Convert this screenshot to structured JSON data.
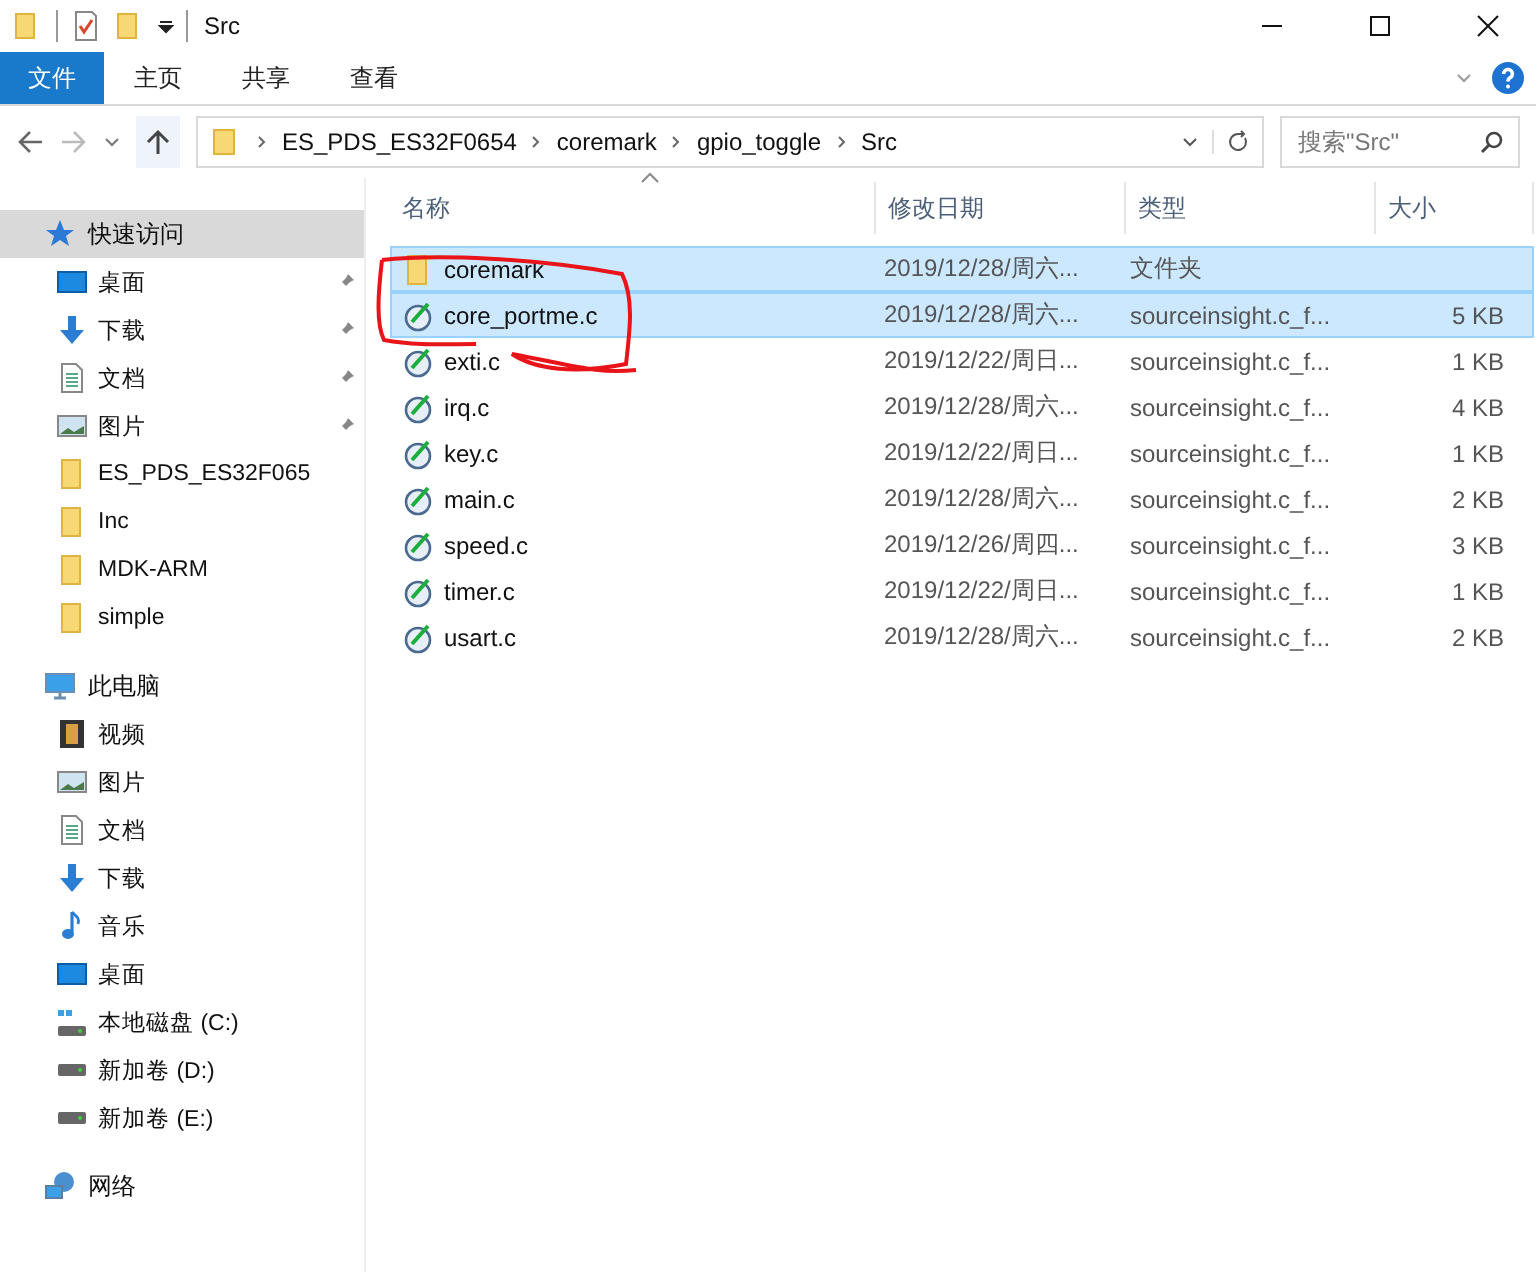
{
  "window": {
    "title": "Src"
  },
  "ribbon_tabs": [
    {
      "label": "文件",
      "kind": "file-menu"
    },
    {
      "label": "主页",
      "kind": "tab"
    },
    {
      "label": "共享",
      "kind": "tab"
    },
    {
      "label": "查看",
      "kind": "tab"
    }
  ],
  "address_bar": {
    "path": [
      "ES_PDS_ES32F0654",
      "coremark",
      "gpio_toggle",
      "Src"
    ]
  },
  "search": {
    "placeholder": "搜索\"Src\""
  },
  "sidebar": {
    "sections": [
      {
        "label": "快速访问",
        "kind": "star",
        "selected": true,
        "children": [
          {
            "label": "桌面",
            "kind": "desktop",
            "pinned": true
          },
          {
            "label": "下载",
            "kind": "download",
            "pinned": true
          },
          {
            "label": "文档",
            "kind": "document",
            "pinned": true
          },
          {
            "label": "图片",
            "kind": "picture",
            "pinned": true
          },
          {
            "label": "ES_PDS_ES32F065",
            "kind": "folder",
            "pinned": false
          },
          {
            "label": "Inc",
            "kind": "folder",
            "pinned": false
          },
          {
            "label": "MDK-ARM",
            "kind": "folder",
            "pinned": false
          },
          {
            "label": "simple",
            "kind": "folder",
            "pinned": false
          }
        ]
      },
      {
        "label": "此电脑",
        "kind": "computer",
        "selected": false,
        "children": [
          {
            "label": "视频",
            "kind": "video",
            "pinned": false
          },
          {
            "label": "图片",
            "kind": "picture",
            "pinned": false
          },
          {
            "label": "文档",
            "kind": "document",
            "pinned": false
          },
          {
            "label": "下载",
            "kind": "download",
            "pinned": false
          },
          {
            "label": "音乐",
            "kind": "music",
            "pinned": false
          },
          {
            "label": "桌面",
            "kind": "desktop",
            "pinned": false
          },
          {
            "label": "本地磁盘 (C:)",
            "kind": "system-drive",
            "pinned": false
          },
          {
            "label": "新加卷 (D:)",
            "kind": "drive",
            "pinned": false
          },
          {
            "label": "新加卷 (E:)",
            "kind": "drive",
            "pinned": false
          }
        ]
      },
      {
        "label": "网络",
        "kind": "network",
        "selected": false
      }
    ]
  },
  "table": {
    "columns": [
      "名称",
      "修改日期",
      "类型",
      "大小"
    ],
    "rows": [
      {
        "name": "coremark",
        "date": "2019/12/28/周六...",
        "type": "文件夹",
        "size": "",
        "kind": "folder",
        "selected": true
      },
      {
        "name": "core_portme.c",
        "date": "2019/12/28/周六...",
        "type": "sourceinsight.c_f...",
        "size": "5 KB",
        "kind": "c-file",
        "selected": true
      },
      {
        "name": "exti.c",
        "date": "2019/12/22/周日...",
        "type": "sourceinsight.c_f...",
        "size": "1 KB",
        "kind": "c-file",
        "selected": false
      },
      {
        "name": "irq.c",
        "date": "2019/12/28/周六...",
        "type": "sourceinsight.c_f...",
        "size": "4 KB",
        "kind": "c-file",
        "selected": false
      },
      {
        "name": "key.c",
        "date": "2019/12/22/周日...",
        "type": "sourceinsight.c_f...",
        "size": "1 KB",
        "kind": "c-file",
        "selected": false
      },
      {
        "name": "main.c",
        "date": "2019/12/28/周六...",
        "type": "sourceinsight.c_f...",
        "size": "2 KB",
        "kind": "c-file",
        "selected": false
      },
      {
        "name": "speed.c",
        "date": "2019/12/26/周四...",
        "type": "sourceinsight.c_f...",
        "size": "3 KB",
        "kind": "c-file",
        "selected": false
      },
      {
        "name": "timer.c",
        "date": "2019/12/22/周日...",
        "type": "sourceinsight.c_f...",
        "size": "1 KB",
        "kind": "c-file",
        "selected": false
      },
      {
        "name": "usart.c",
        "date": "2019/12/28/周六...",
        "type": "sourceinsight.c_f...",
        "size": "2 KB",
        "kind": "c-file",
        "selected": false
      }
    ]
  }
}
